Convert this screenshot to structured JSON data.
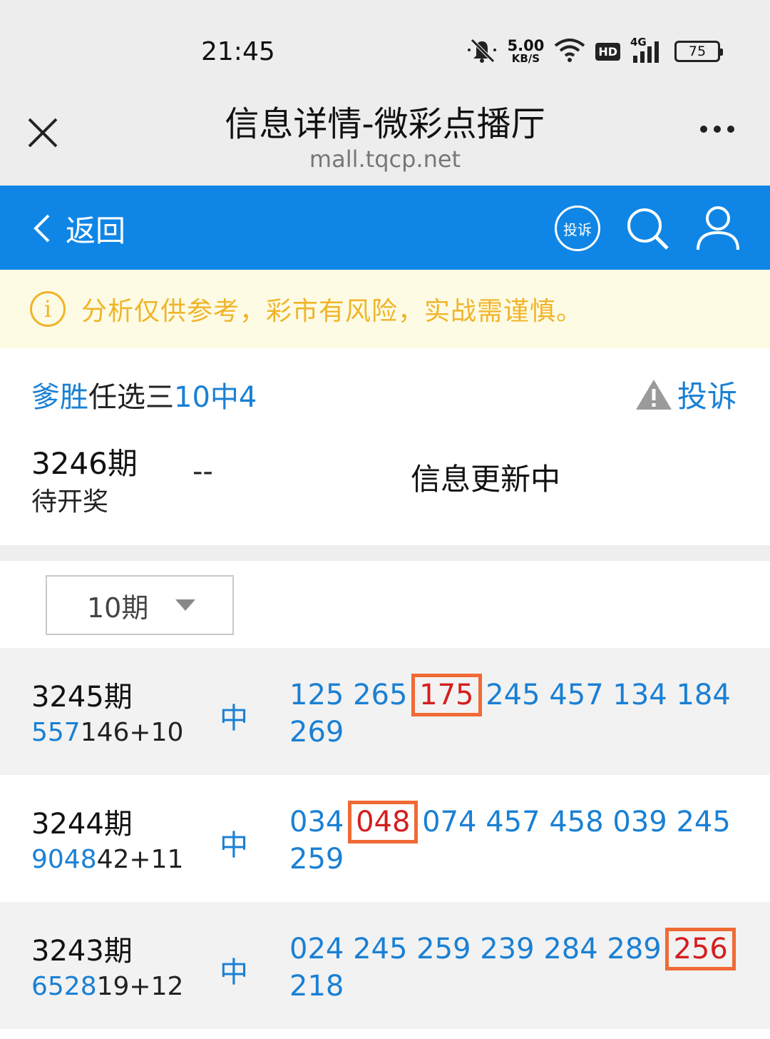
{
  "status_bar": {
    "time": "21:45",
    "net_speed_value": "5.00",
    "net_speed_unit": "KB/S",
    "hd_label": "HD",
    "signal_label": "4G",
    "battery": "75",
    "icons": [
      "mute-icon",
      "wifi-icon",
      "signal-icon",
      "battery-icon"
    ]
  },
  "title_bar": {
    "title": "信息详情-微彩点播厅",
    "url": "mall.tqcp.net"
  },
  "nav": {
    "back_label": "返回",
    "complain_badge": "投诉",
    "accent_color": "#0f86e6"
  },
  "notice": {
    "icon_glyph": "i",
    "text": "分析仅供参考，彩市有风险，实战需谨慎。",
    "color": "#f0b429"
  },
  "info": {
    "title_part1": "爹胜",
    "title_part2": "任选三",
    "title_part3": "10中4",
    "report_label": "投诉",
    "current_period": "3246期",
    "current_status": "待开奖",
    "current_dash": "--",
    "current_update": "信息更新中"
  },
  "selector": {
    "value": "10期"
  },
  "records": [
    {
      "period": "3245期",
      "code_blue": "557",
      "code_dark": "146+10",
      "status": "中",
      "numbers": [
        "125",
        "265",
        "175",
        "245",
        "457",
        "134",
        "184",
        "269"
      ],
      "hit_index": 2
    },
    {
      "period": "3244期",
      "code_blue": "9048",
      "code_dark": "42+11",
      "status": "中",
      "numbers": [
        "034",
        "048",
        "074",
        "457",
        "458",
        "039",
        "245",
        "259"
      ],
      "hit_index": 1
    },
    {
      "period": "3243期",
      "code_blue": "6528",
      "code_dark": "19+12",
      "status": "中",
      "numbers": [
        "024",
        "245",
        "259",
        "239",
        "284",
        "289",
        "256",
        "218"
      ],
      "hit_index": 6
    }
  ]
}
